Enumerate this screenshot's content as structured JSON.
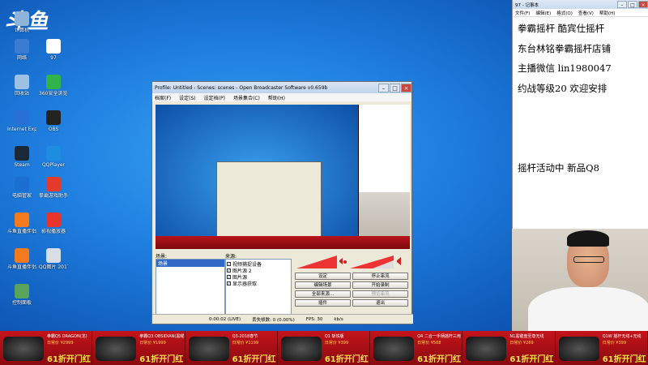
{
  "desktop": {
    "logo": "斗鱼",
    "icons": [
      {
        "label": "计算机",
        "name": "computer-icon",
        "color": "#8fb4d9"
      },
      {
        "label": "网络",
        "name": "network-icon",
        "color": "#3b7bd1"
      },
      {
        "label": "97",
        "name": "file-icon",
        "color": "#ffffff"
      },
      {
        "label": "回收站",
        "name": "recycle-bin-icon",
        "color": "#9ec0e4"
      },
      {
        "label": "360安全浏览器",
        "name": "browser-360-icon",
        "color": "#2fb34a"
      },
      {
        "label": "Internet Explorer",
        "name": "ie-icon",
        "color": "#2a6fd6"
      },
      {
        "label": "OBS",
        "name": "obs-icon",
        "color": "#222222"
      },
      {
        "label": "Steam",
        "name": "steam-icon",
        "color": "#1b2838"
      },
      {
        "label": "QQPlayer",
        "name": "qqplayer-icon",
        "color": "#1c8de0"
      },
      {
        "label": "电脑管家",
        "name": "pc-manager-icon",
        "color": "#1a6fd0"
      },
      {
        "label": "拳霸游戏助手",
        "name": "game-assist-icon",
        "color": "#e43c2c"
      },
      {
        "label": "斗鱼直播伴侣",
        "name": "douyu-companion-icon",
        "color": "#f47a20"
      },
      {
        "label": "影视播放器",
        "name": "video-player-icon",
        "color": "#e8332a"
      },
      {
        "label": "斗鱼直播伴侣",
        "name": "douyu-companion-icon-2",
        "color": "#f47a20"
      },
      {
        "label": "QQ图片 20170911...",
        "name": "image-file-icon",
        "color": "#d7dee8"
      },
      {
        "label": "控制面板",
        "name": "control-panel-icon",
        "color": "#5aa35a"
      }
    ]
  },
  "obs": {
    "title": "Profile: Untitled - Scenes: scenes - Open Broadcaster Software v0.659b",
    "menu": [
      "档案(F)",
      "设定(S)",
      "设定档(P)",
      "场景集合(C)",
      "帮助(H)"
    ],
    "scenes_label": "场景:",
    "sources_label": "来源:",
    "scene_item": "场景",
    "sources": [
      "视频捕捉设备",
      "图片源 2",
      "图片源",
      "显示器获取"
    ],
    "buttons": [
      {
        "label": "设定",
        "name": "settings-button",
        "dim": false
      },
      {
        "label": "停止串流",
        "name": "stop-stream-button",
        "dim": false
      },
      {
        "label": "编辑场景",
        "name": "edit-scene-button",
        "dim": false
      },
      {
        "label": "开始录制",
        "name": "start-record-button",
        "dim": false
      },
      {
        "label": "全部来源...",
        "name": "global-sources-button",
        "dim": false
      },
      {
        "label": "预览串流",
        "name": "preview-stream-button",
        "dim": true
      },
      {
        "label": "插件",
        "name": "plugins-button",
        "dim": false
      },
      {
        "label": "退出",
        "name": "exit-button",
        "dim": false
      }
    ],
    "status": {
      "time": "0:00:02 (LIVE)",
      "dropped": "丢失帧数: 0 (0.00%)",
      "fps": "FPS: 30",
      "bitrate": "kb/s"
    }
  },
  "notepad": {
    "title": "97 - 记事本",
    "menu": [
      "文件(F)",
      "编辑(E)",
      "格式(O)",
      "查看(V)",
      "帮助(H)"
    ],
    "lines": [
      "拳霸摇杆  酷宾仕摇杆",
      "东台林铭拳霸摇杆店铺",
      "主播微信  lin1980047",
      "约战等级20 欢迎安排",
      "",
      "",
      "",
      "摇杆活动中  新品Q8"
    ]
  },
  "banner": {
    "products": [
      {
        "name": "拳霸Q5 DRAGON(龙)",
        "price": "日常价 ¥2999",
        "deal": "61折开门红 1699",
        "unit": "元"
      },
      {
        "name": "拳霸Q3 OBSIDIAN(黑曜石)",
        "price": "日常价 ¥1999",
        "deal": "61折开门红 1099",
        "unit": "元"
      },
      {
        "name": "Q3-2018春节",
        "price": "日常价 ¥1199",
        "deal": "61折开门红 949",
        "unit": "元"
      },
      {
        "name": "Q1 斩铁版",
        "price": "日常价 ¥399",
        "deal": "61折开门红 268",
        "unit": "元"
      },
      {
        "name": "Q4 二合一手柄摇杆三用",
        "price": "日常价 ¥568",
        "deal": "61折开门红 508",
        "unit": "元"
      },
      {
        "name": "N1黑键盘至尊无线",
        "price": "日常价 ¥269",
        "deal": "61折开门红 239",
        "unit": "元"
      },
      {
        "name": "Q1W 摇杆无线+无线",
        "price": "日常价 ¥399",
        "deal": "61折开门红 309",
        "unit": "元"
      }
    ]
  }
}
